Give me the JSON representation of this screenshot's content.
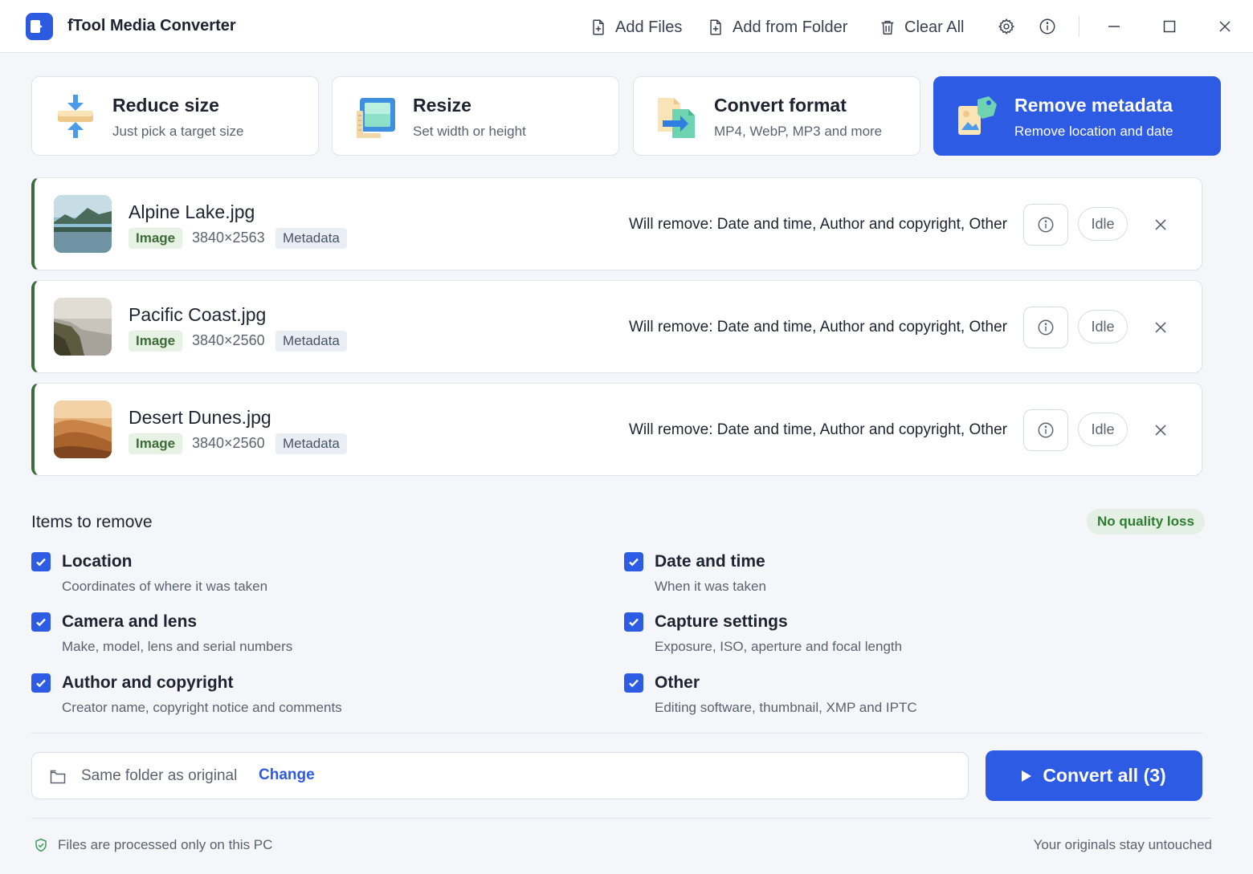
{
  "app": {
    "title": "fTool Media Converter"
  },
  "toolbar": {
    "add_files": "Add Files",
    "add_from_folder": "Add from Folder",
    "clear_all": "Clear All"
  },
  "modes": [
    {
      "title": "Reduce size",
      "subtitle": "Just pick a target size",
      "active": false
    },
    {
      "title": "Resize",
      "subtitle": "Set width or height",
      "active": false
    },
    {
      "title": "Convert format",
      "subtitle": "MP4, WebP, MP3 and more",
      "active": false
    },
    {
      "title": "Remove metadata",
      "subtitle": "Remove location and date",
      "active": true
    }
  ],
  "files": [
    {
      "name": "Alpine Lake.jpg",
      "type": "Image",
      "dims": "3840×2563",
      "meta": "Metadata",
      "will_remove": "Will remove: Date and time, Author and copyright, Other",
      "status": "Idle"
    },
    {
      "name": "Pacific Coast.jpg",
      "type": "Image",
      "dims": "3840×2560",
      "meta": "Metadata",
      "will_remove": "Will remove: Date and time, Author and copyright, Other",
      "status": "Idle"
    },
    {
      "name": "Desert Dunes.jpg",
      "type": "Image",
      "dims": "3840×2560",
      "meta": "Metadata",
      "will_remove": "Will remove: Date and time, Author and copyright, Other",
      "status": "Idle"
    }
  ],
  "items_section": {
    "title": "Items to remove",
    "quality_badge": "No quality loss",
    "items": [
      {
        "label": "Location",
        "desc": "Coordinates of where it was taken",
        "checked": true
      },
      {
        "label": "Date and time",
        "desc": "When it was taken",
        "checked": true
      },
      {
        "label": "Camera and lens",
        "desc": "Make, model, lens and serial numbers",
        "checked": true
      },
      {
        "label": "Capture settings",
        "desc": "Exposure, ISO, aperture and focal length",
        "checked": true
      },
      {
        "label": "Author and copyright",
        "desc": "Creator name, copyright notice and comments",
        "checked": true
      },
      {
        "label": "Other",
        "desc": "Editing software, thumbnail, XMP and IPTC",
        "checked": true
      }
    ]
  },
  "output": {
    "folder_text": "Same folder as original",
    "change_label": "Change",
    "convert_label": "Convert all (3)"
  },
  "footer": {
    "left": "Files are processed only on this PC",
    "right": "Your originals stay untouched"
  },
  "colors": {
    "accent": "#2d5be3",
    "row_accent": "#3e6b3c",
    "success": "#2e7d32"
  }
}
